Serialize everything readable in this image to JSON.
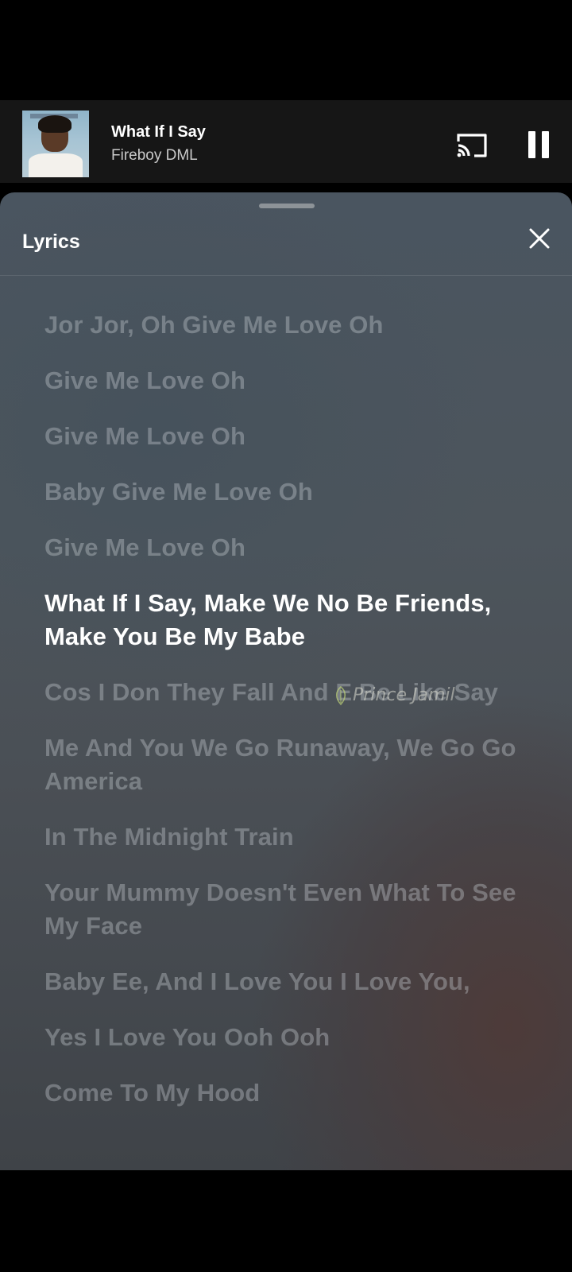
{
  "mini_player": {
    "title": "What If I Say",
    "artist": "Fireboy DML",
    "cast_icon": "cast-icon",
    "pause_icon": "pause-icon"
  },
  "lyrics_sheet": {
    "title": "Lyrics",
    "close_icon": "close-icon",
    "active_index": 5,
    "lines": [
      "Jor Jor, Oh Give Me Love Oh",
      "Give Me Love Oh",
      "Give Me Love Oh",
      "Baby Give Me Love Oh",
      "Give Me Love Oh",
      "What If I Say, Make We No Be Friends, Make You Be My Babe",
      "Cos I Don They Fall And E Be Like Say",
      "Me And You We Go Runaway, We Go Go America",
      "In The Midnight Train",
      "Your Mummy Doesn't Even What To See My Face",
      "Baby Ee, And I Love You I Love You,",
      "Yes I Love You Ooh Ooh",
      "Come To My Hood"
    ]
  },
  "watermark": "Prince Jamil",
  "colors": {
    "active_lyric": "#ffffff",
    "inactive_lyric": "rgba(200,205,210,0.38)",
    "mini_player_bg": "#161616"
  }
}
